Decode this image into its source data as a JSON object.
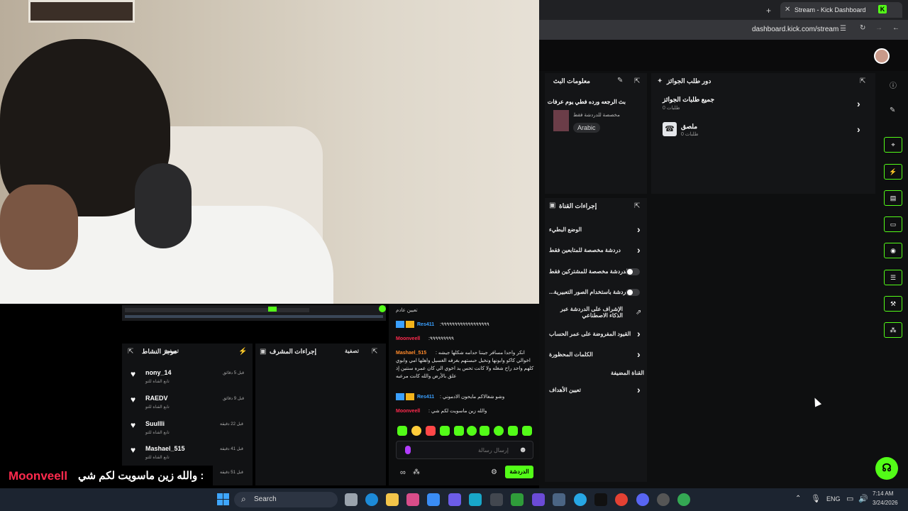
{
  "browser": {
    "tab_title": "Stream - Kick Dashboard",
    "url": "dashboard.kick.com/stream"
  },
  "stream_info": {
    "panel_title": "معلومات البث",
    "stream_title": "بث الرجعه ورده فطي يوم عرفات",
    "category": "مخصصة للدردشة فقط",
    "language": "Arabic"
  },
  "rewards": {
    "panel_title": "دور طلب الجوائز",
    "items": [
      {
        "title": "جميع طلبات الجوائز",
        "sub": "0 طلبات"
      },
      {
        "title": "ملصق",
        "sub": "0 طلبات"
      }
    ]
  },
  "channel_actions": {
    "panel_title": "إجراءات القناة",
    "items": [
      {
        "label": "الوضع البطيء",
        "control": "chevron"
      },
      {
        "label": "دردشة مخصصة للمتابعين فقط",
        "control": "chevron"
      },
      {
        "label": "الدردشة مخصصة للمشتركين فقط",
        "control": "toggle"
      },
      {
        "label": "...دردشة باستخدام الصور التعبيرية",
        "control": "toggle"
      },
      {
        "label": "الإشراف على الدردشة عبر الذكاء الاصطناعي",
        "control": "link"
      },
      {
        "label": "القيود المفروضة على عمر الحساب",
        "control": "chevron"
      },
      {
        "label": "الكلمات المحظورة",
        "control": "chevron"
      },
      {
        "label": "القناة المضيفة",
        "control": "none"
      },
      {
        "label": "تعيين الأهداف",
        "control": "chevron"
      }
    ]
  },
  "activity": {
    "panel_title": "موجز النشاط",
    "filter_label": "تصفية",
    "items": [
      {
        "name": "nony_14",
        "sub": "تابع القناة للتو",
        "time": "قبل 5 دقائق"
      },
      {
        "name": "RAEDV",
        "sub": "تابع القناة للتو",
        "time": "قبل 9 دقائق"
      },
      {
        "name": "Suullli",
        "sub": "تابع القناة للتو",
        "time": "قبل 22 دقيقة"
      },
      {
        "name": "Mashael_515",
        "sub": "تابع القناة للتو",
        "time": "قبل 41 دقيقة"
      },
      {
        "name": "",
        "sub": "",
        "time": "قبل 51 دقيقة"
      }
    ]
  },
  "mod_actions": {
    "panel_title": "إجراءات المشرف",
    "filter_label": "تصفية"
  },
  "chat": {
    "top_line": "تعيين عادم",
    "messages": [
      {
        "user": "Res411",
        "text": ":٩٩٩٩٩٩٩٩٩٩٩٩٩٩٩٩٩٩",
        "user_color": "blue"
      },
      {
        "user": "Moonveell",
        "text": ":٩٩٩٩٩٩٩٩٩",
        "user_color": "red"
      },
      {
        "user": "Mashael_515",
        "text": ": انكر واحدا مسافر جيننا حدامه شكلها جيشه اخوالي كاكو وابونها ونخيل حبستهم بغرفه الغسيل واهلها امي وابوي كلهم واحد راح شغله ولا كانت تحس يد اخوي الي كان عمره سنتين إذ علق بالأرض والله كانت مرعبه",
        "user_color": "orange"
      },
      {
        "user": "Res411",
        "text": ": وشو شغالاكم مايحون الادموني",
        "user_color": "blue"
      },
      {
        "user": "Moonveell",
        "text": ": والله زين ماسويت لكم شي",
        "user_color": "red"
      }
    ],
    "input_placeholder": "إرسال رسالة",
    "send_label": "الدردشة"
  },
  "overlay_chat": {
    "user": "Moonveell",
    "text": "والله زين ماسويت لكم شي :"
  },
  "taskbar": {
    "search_label": "Search",
    "lang": "ENG",
    "time": "7:14 AM",
    "date": "3/24/2026"
  },
  "colors": {
    "kick_green": "#53fc18",
    "overlay_red": "#ff2a4d"
  }
}
